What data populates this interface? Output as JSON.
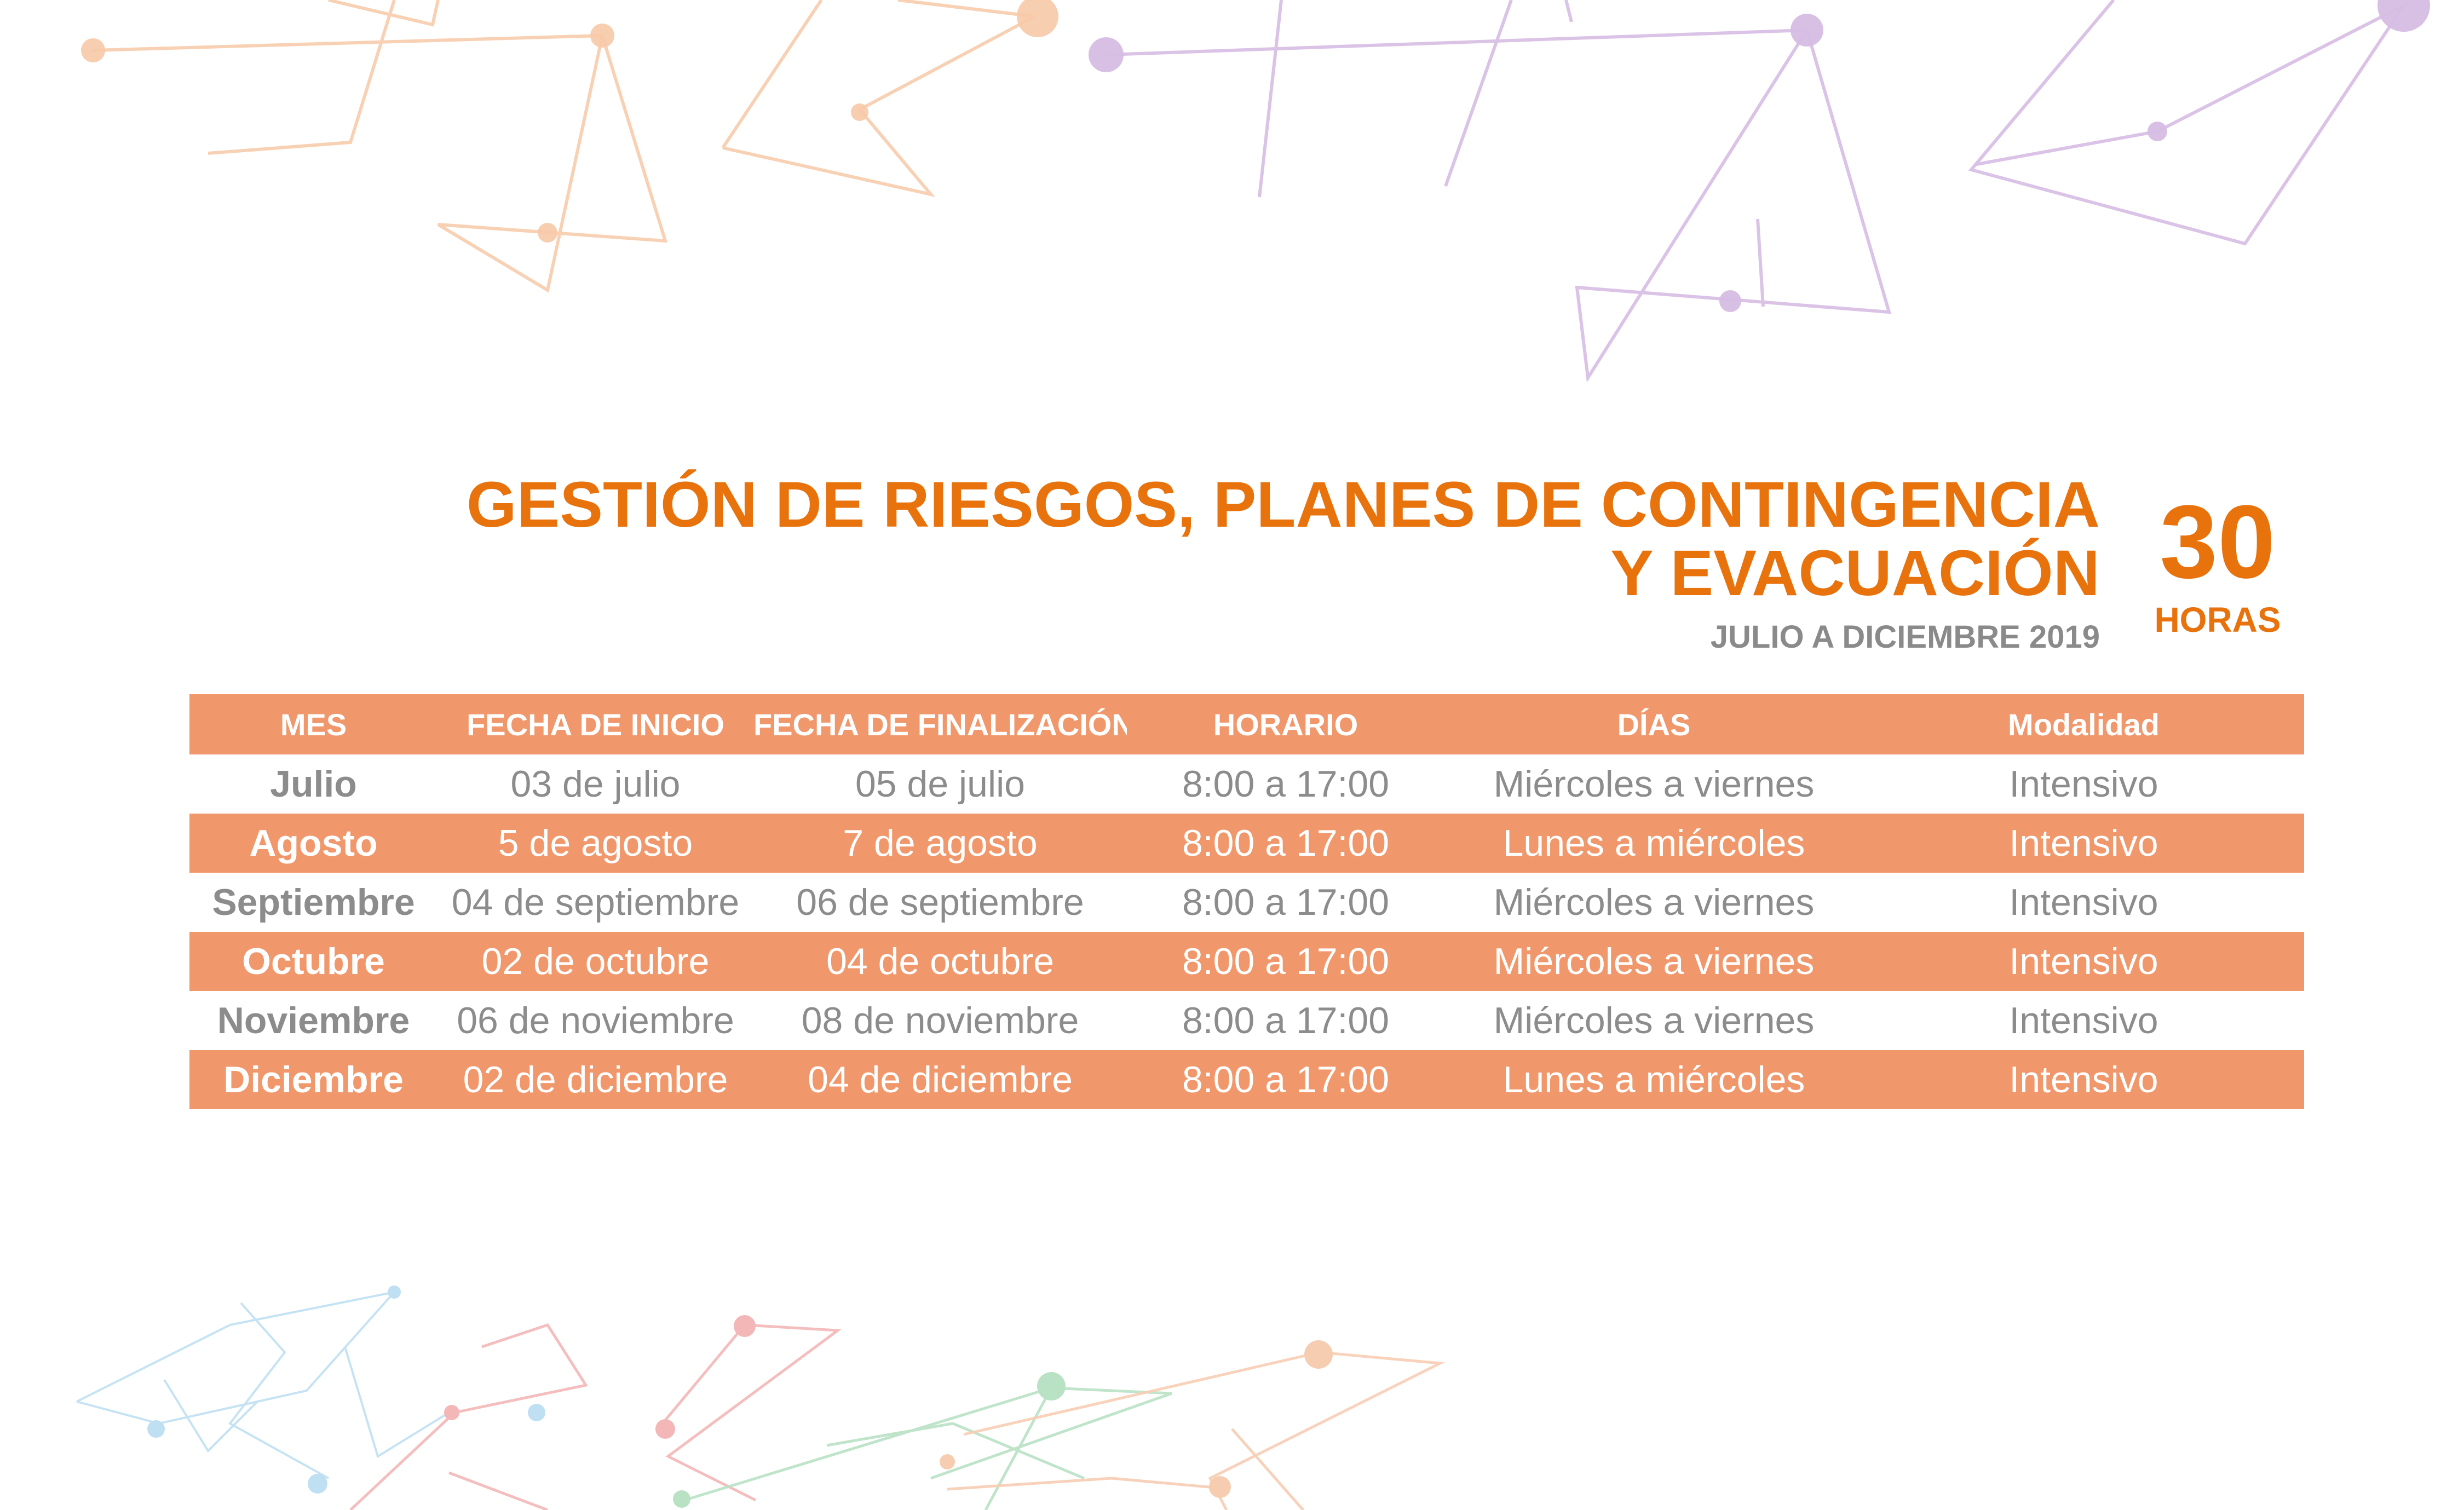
{
  "title": {
    "line1": "GESTIÓN DE RIESGOS, PLANES DE CONTINGENCIA",
    "line2": "Y EVACUACIÓN",
    "subtitle": "JULIO A DICIEMBRE 2019"
  },
  "hours": {
    "value": "30",
    "label": "HORAS"
  },
  "colors": {
    "accent": "#e8720c",
    "row_highlight": "#f0976b",
    "text_gray": "#8c8c8c"
  },
  "table": {
    "headers": [
      "MES",
      "FECHA DE INICIO",
      "FECHA DE FINALIZACIÓN",
      "HORARIO",
      "DÍAS",
      "Modalidad"
    ],
    "rows": [
      [
        "Julio",
        "03 de julio",
        "05 de julio",
        "8:00 a 17:00",
        "Miércoles a viernes",
        "Intensivo"
      ],
      [
        "Agosto",
        "5 de agosto",
        "7 de agosto",
        "8:00 a 17:00",
        "Lunes a miércoles",
        "Intensivo"
      ],
      [
        "Septiembre",
        "04 de septiembre",
        "06 de septiembre",
        "8:00 a 17:00",
        "Miércoles a viernes",
        "Intensivo"
      ],
      [
        "Octubre",
        "02 de octubre",
        "04 de octubre",
        "8:00 a 17:00",
        "Miércoles a viernes",
        "Intensivo"
      ],
      [
        "Noviembre",
        "06 de noviembre",
        "08 de noviembre",
        "8:00 a 17:00",
        "Miércoles a viernes",
        "Intensivo"
      ],
      [
        "Diciembre",
        "02 de diciembre",
        "04 de diciembre",
        "8:00 a 17:00",
        "Lunes a miércoles",
        "Intensivo"
      ]
    ]
  }
}
